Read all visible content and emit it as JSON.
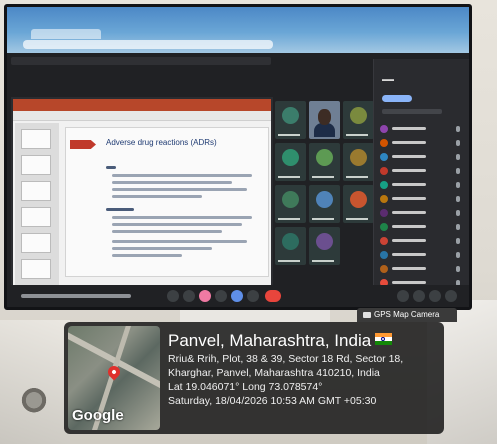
{
  "slide": {
    "title": "Adverse drug reactions (ADRs)"
  },
  "gps_camera": {
    "badge_label": "GPS Map Camera",
    "map_brand": "Google",
    "place": "Panvel, Maharashtra, India",
    "address_line_1": "Rriu& Rrih, Plot, 38 & 39, Sector 18 Rd, Sector 18,",
    "address_line_2": "Kharghar, Panvel, Maharashtra 410210, India",
    "coordinates": "Lat 19.046071° Long 73.078574°",
    "datetime": "Saturday, 18/04/2026 10:53 AM GMT +05:30"
  },
  "colors": {
    "accent_red": "#e8453c",
    "ppt_ribbon": "#b7472a",
    "slide_title": "#1f3b73"
  },
  "icons": [
    "camera-icon",
    "location-pin-icon",
    "india-flag-icon"
  ]
}
